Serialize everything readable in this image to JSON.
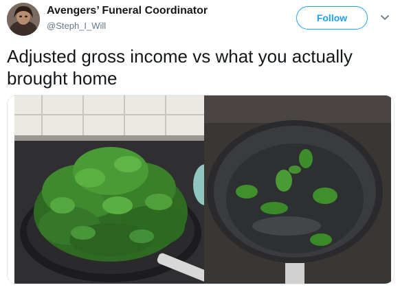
{
  "tweet": {
    "author_name": "Avengers’ Funeral Coordinator",
    "author_handle": "@Steph_I_Will",
    "follow_label": "Follow",
    "text": "Adjusted gross income vs what you actually brought home",
    "timestamp_partial": ""
  },
  "icons": {
    "caret": "chevron-down-icon"
  },
  "colors": {
    "accent": "#1da1f2",
    "text_primary": "#14171a",
    "text_secondary": "#657786"
  }
}
